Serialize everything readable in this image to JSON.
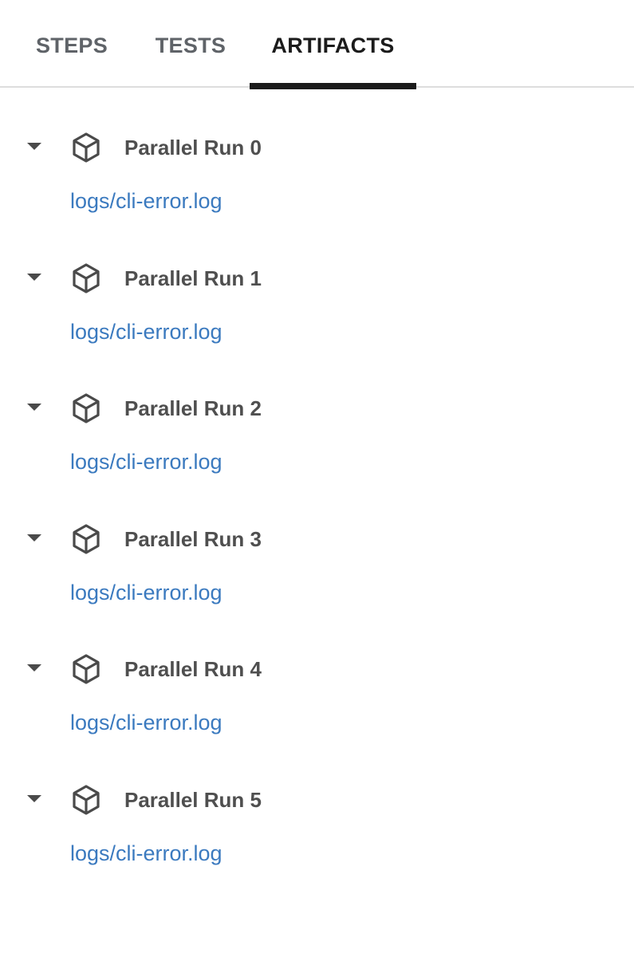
{
  "tabs": [
    {
      "label": "STEPS",
      "active": false
    },
    {
      "label": "TESTS",
      "active": false
    },
    {
      "label": "ARTIFACTS",
      "active": true
    }
  ],
  "groups": [
    {
      "title": "Parallel Run 0",
      "icon": "cube-icon",
      "expanded": true,
      "artifacts": [
        "logs/cli-error.log"
      ]
    },
    {
      "title": "Parallel Run 1",
      "icon": "cube-icon",
      "expanded": true,
      "artifacts": [
        "logs/cli-error.log"
      ]
    },
    {
      "title": "Parallel Run 2",
      "icon": "cube-icon",
      "expanded": true,
      "artifacts": [
        "logs/cli-error.log"
      ]
    },
    {
      "title": "Parallel Run 3",
      "icon": "cube-icon",
      "expanded": true,
      "artifacts": [
        "logs/cli-error.log"
      ]
    },
    {
      "title": "Parallel Run 4",
      "icon": "cube-icon",
      "expanded": true,
      "artifacts": [
        "logs/cli-error.log"
      ]
    },
    {
      "title": "Parallel Run 5",
      "icon": "cube-icon",
      "expanded": true,
      "artifacts": [
        "logs/cli-error.log"
      ]
    }
  ],
  "colors": {
    "active_tab": "#1b1b1b",
    "inactive_tab": "#5f6368",
    "link": "#3b7abf",
    "group_title": "#4f4f4f"
  }
}
